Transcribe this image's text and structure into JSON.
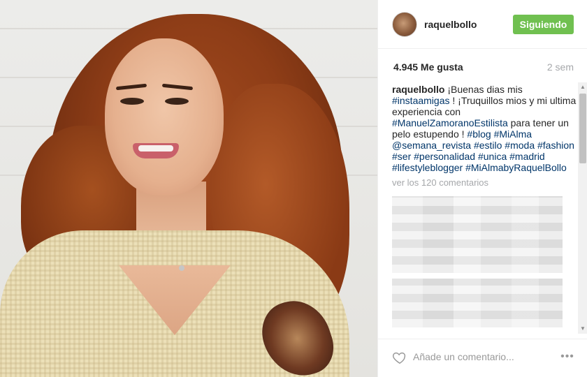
{
  "post": {
    "username": "raquelbollo",
    "follow_label": "Siguiendo",
    "likes": "4.945 Me gusta",
    "time": "2 sem"
  },
  "caption": {
    "user": "raquelbollo",
    "t1": " ¡Buenas dias mis ",
    "tag1": "#instaamigas",
    "t2": " ! ¡Truquillos mios y mi ultima experiencia con ",
    "tag2": "#ManuelZamoranoEstilista",
    "t3": " para tener un pelo estupendo ! ",
    "tag3": "#blog",
    "t4": " ",
    "tag4": "#MiAlma",
    "t5": " ",
    "tag5": "@semana_revista",
    "t6": " ",
    "tag6": "#estilo",
    "t7": " ",
    "tag7": "#moda",
    "t8": " ",
    "tag8": "#fashion",
    "t9": " ",
    "tag9": "#ser",
    "t10": " ",
    "tag10": "#personalidad",
    "t11": " ",
    "tag11": "#unica",
    "t12": " ",
    "tag12": "#madrid",
    "t13": " ",
    "tag13": "#lifestyleblogger",
    "t14": " ",
    "tag14": "#MiAlmabyRaquelBollo"
  },
  "view_all_comments": "ver los 120 comentarios",
  "footer": {
    "comment_placeholder": "Añade un comentario...",
    "more_label": "•••"
  },
  "colors": {
    "follow_green": "#70c050",
    "hashtag": "#003569",
    "muted": "#a5a7aa"
  },
  "icons": {
    "heart": "heart-icon",
    "more": "more-options-icon"
  }
}
